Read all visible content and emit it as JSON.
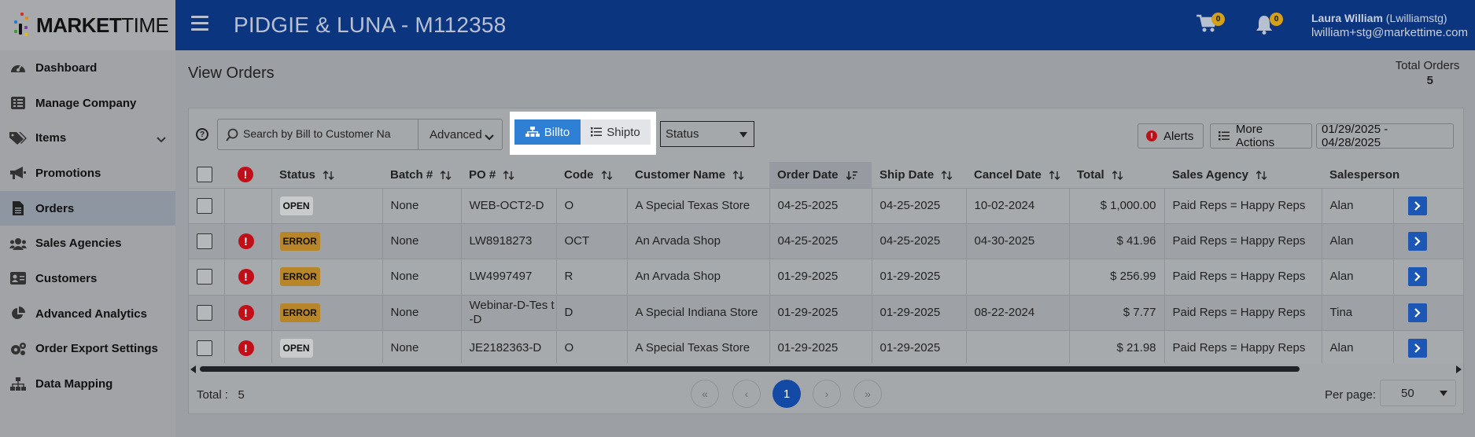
{
  "app": {
    "logo_bold": "MARKET",
    "logo_thin": "TIME",
    "company_title": "PIDGIE & LUNA - M112358"
  },
  "header": {
    "cart_count": "0",
    "notification_count": "0",
    "user_name": "Laura William",
    "user_id": "(Lwilliamstg)",
    "user_email": "lwilliam+stg@markettime.com"
  },
  "sidebar": {
    "items": [
      {
        "label": "Dashboard",
        "icon": "gauge-icon"
      },
      {
        "label": "Manage Company",
        "icon": "list-icon"
      },
      {
        "label": "Items",
        "icon": "tags-icon"
      },
      {
        "label": "Promotions",
        "icon": "megaphone-icon"
      },
      {
        "label": "Orders",
        "icon": "document-icon"
      },
      {
        "label": "Sales Agencies",
        "icon": "users-icon"
      },
      {
        "label": "Customers",
        "icon": "id-card-icon"
      },
      {
        "label": "Advanced Analytics",
        "icon": "pie-chart-icon"
      },
      {
        "label": "Order Export Settings",
        "icon": "gears-icon"
      },
      {
        "label": "Data Mapping",
        "icon": "sitemap-icon"
      }
    ]
  },
  "page": {
    "title": "View Orders",
    "total_orders_label": "Total Orders",
    "total_orders_value": "5"
  },
  "toolbar": {
    "search_placeholder": "Search by Bill to Customer Na",
    "advanced_label": "Advanced",
    "billto_label": "Billto",
    "shipto_label": "Shipto",
    "status_label": "Status",
    "alerts_label": "Alerts",
    "more_actions_label": "More Actions",
    "date_range": "01/29/2025 - 04/28/2025"
  },
  "table": {
    "columns": [
      "Status",
      "Batch #",
      "PO #",
      "Code",
      "Customer Name",
      "Order Date",
      "Ship Date",
      "Cancel Date",
      "Total",
      "Sales Agency",
      "Salesperson"
    ],
    "rows": [
      {
        "error": false,
        "status": "OPEN",
        "batch": "None",
        "po": "WEB-OCT2-D",
        "code": "O",
        "customer": "A Special Texas Store",
        "order_date": "04-25-2025",
        "ship_date": "04-25-2025",
        "cancel_date": "10-02-2024",
        "total": "$ 1,000.00",
        "agency": "Paid Reps = Happy Reps",
        "salesperson": "Alan"
      },
      {
        "error": true,
        "status": "ERROR",
        "batch": "None",
        "po": "LW8918273",
        "code": "OCT",
        "customer": "An Arvada Shop",
        "order_date": "04-25-2025",
        "ship_date": "04-25-2025",
        "cancel_date": "04-30-2025",
        "total": "$ 41.96",
        "agency": "Paid Reps = Happy Reps",
        "salesperson": "Alan"
      },
      {
        "error": true,
        "status": "ERROR",
        "batch": "None",
        "po": "LW4997497",
        "code": "R",
        "customer": "An Arvada Shop",
        "order_date": "01-29-2025",
        "ship_date": "01-29-2025",
        "cancel_date": "",
        "total": "$ 256.99",
        "agency": "Paid Reps = Happy Reps",
        "salesperson": "Alan"
      },
      {
        "error": true,
        "status": "ERROR",
        "batch": "None",
        "po": "Webinar-D-Tes t-D",
        "code": "D",
        "customer": "A Special Indiana Store",
        "order_date": "01-29-2025",
        "ship_date": "01-29-2025",
        "cancel_date": "08-22-2024",
        "total": "$ 7.77",
        "agency": "Paid Reps = Happy Reps",
        "salesperson": "Tina"
      },
      {
        "error": true,
        "status": "OPEN",
        "batch": "None",
        "po": "JE2182363-D",
        "code": "O",
        "customer": "A Special Texas Store",
        "order_date": "01-29-2025",
        "ship_date": "01-29-2025",
        "cancel_date": "",
        "total": "$ 21.98",
        "agency": "Paid Reps = Happy Reps",
        "salesperson": "Alan"
      }
    ]
  },
  "footer": {
    "total_label": "Total :",
    "total_value": "5",
    "pager_first": "«",
    "pager_prev": "‹",
    "current_page": "1",
    "pager_next": "›",
    "pager_last": "»",
    "per_page_label": "Per page:",
    "per_page_value": "50"
  },
  "colors": {
    "header_bg": "#0c3580",
    "billto_active": "#2f7fd4",
    "error_red": "#c10f1a",
    "error_badge": "#b8862a",
    "action_blue": "#1d57b5"
  }
}
